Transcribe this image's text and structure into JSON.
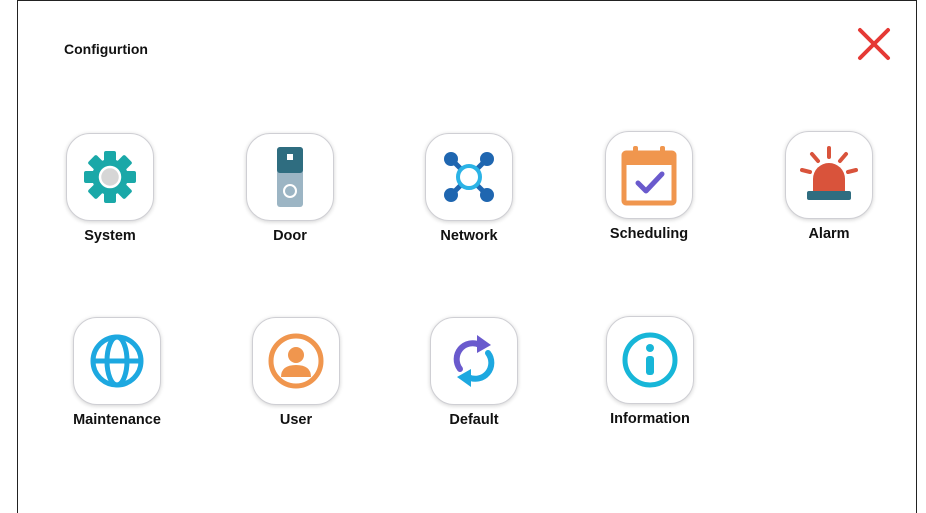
{
  "header": {
    "title": "Configurtion",
    "close_icon": "close-icon",
    "close_color": "#e53935"
  },
  "menu": {
    "items": [
      {
        "label": "System",
        "icon": "gear-icon",
        "color": "#1aa8a8"
      },
      {
        "label": "Door",
        "icon": "door-station-icon",
        "color": "#2f6d80"
      },
      {
        "label": "Network",
        "icon": "network-icon",
        "color": "#1f66b0"
      },
      {
        "label": "Scheduling",
        "icon": "calendar-icon",
        "color": "#f0964e"
      },
      {
        "label": "Alarm",
        "icon": "siren-icon",
        "color": "#d9533b"
      },
      {
        "label": "Maintenance",
        "icon": "globe-icon",
        "color": "#1da8e0"
      },
      {
        "label": "User",
        "icon": "user-icon",
        "color": "#f0964e"
      },
      {
        "label": "Default",
        "icon": "reset-icon",
        "color": "#6a5acd"
      },
      {
        "label": "Information",
        "icon": "info-icon",
        "color": "#17b6d8"
      }
    ]
  }
}
